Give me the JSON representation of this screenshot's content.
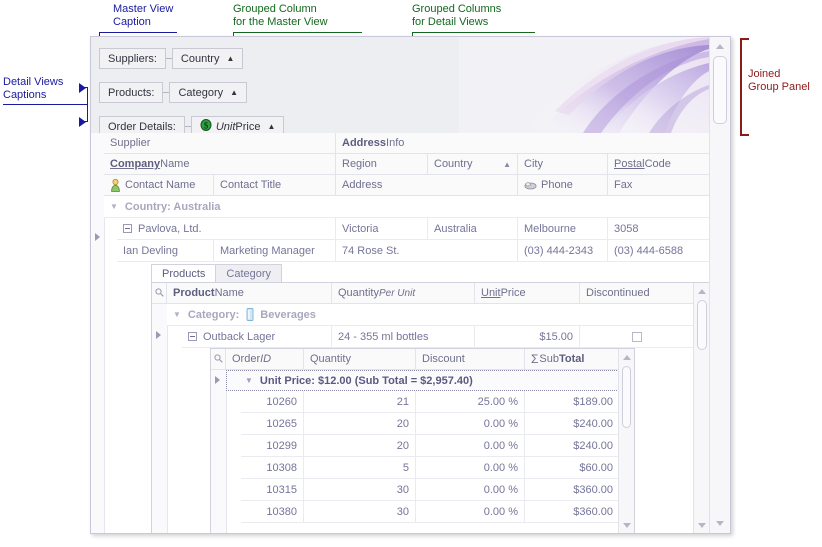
{
  "annotations": {
    "master_view_caption": "Master View\nCaption",
    "grouped_column_master": "Grouped Column\nfor the Master View",
    "grouped_columns_detail": "Grouped Columns\nfor Detail Views",
    "detail_views_captions": "Detail Views\nCaptions",
    "joined_group_panel": "Joined\nGroup Panel"
  },
  "group_panel": {
    "rows": [
      {
        "caption": "Suppliers:",
        "column": "Country",
        "sort": "▲",
        "icon": "",
        "italic_prefix": ""
      },
      {
        "caption": "Products:",
        "column": "Category",
        "sort": "▲",
        "icon": "",
        "italic_prefix": ""
      },
      {
        "caption": "Order Details:",
        "column": "Price",
        "sort": "▲",
        "icon": "money-icon",
        "italic_prefix": "Unit"
      }
    ]
  },
  "master_grid": {
    "band_supplier": "Supplier",
    "band_address_bold": "Address",
    "band_address_rest": " Info",
    "headers": {
      "company_name_bold": "Company",
      "company_name_rest": " Name",
      "region": "Region",
      "country": "Country",
      "country_sort": "▲",
      "city": "City",
      "postal_bold": "Postal",
      "postal_rest": " Code",
      "contact_name": "Contact Name",
      "contact_title": "Contact Title",
      "address": "Address",
      "phone": "Phone",
      "fax": "Fax"
    },
    "group_row": "Country: Australia",
    "row": {
      "company": "Pavlova, Ltd.",
      "region": "Victoria",
      "country": "Australia",
      "city": "Melbourne",
      "postal": "3058",
      "contact_name": "Ian Devling",
      "contact_title": "Marketing Manager",
      "address": "74 Rose St.",
      "phone": "(03) 444-2343",
      "fax": "(03) 444-6588"
    }
  },
  "products_view": {
    "tabs": [
      {
        "label": "Products",
        "active": true
      },
      {
        "label": "Category",
        "active": false
      }
    ],
    "headers": {
      "product_bold": "Product",
      "product_rest": " Name",
      "quantity": "Quantity ",
      "quantity_ital": "Per Unit",
      "unit_underline": "Unit",
      "unit_rest": " Price",
      "discontinued": "Discontinued"
    },
    "group_row_label": "Category:",
    "group_row_value": "Beverages",
    "row": {
      "name": "Outback Lager",
      "quantity": "24 - 355 ml bottles",
      "price": "$15.00",
      "discontinued": false
    }
  },
  "order_details_view": {
    "headers": {
      "order_text": "Order ",
      "order_ital": "ID",
      "quantity": "Quantity",
      "discount": "Discount",
      "sum_glyph": "Σ",
      "subtotal_pre": " Sub ",
      "subtotal_bold": "Total"
    },
    "group_row": "Unit Price: $12.00 (Sub Total = $2,957.40)",
    "rows": [
      {
        "order_id": "10260",
        "quantity": "21",
        "discount": "25.00 %",
        "subtotal": "$189.00"
      },
      {
        "order_id": "10265",
        "quantity": "20",
        "discount": "0.00 %",
        "subtotal": "$240.00"
      },
      {
        "order_id": "10299",
        "quantity": "20",
        "discount": "0.00 %",
        "subtotal": "$240.00"
      },
      {
        "order_id": "10308",
        "quantity": "5",
        "discount": "0.00 %",
        "subtotal": "$60.00"
      },
      {
        "order_id": "10315",
        "quantity": "30",
        "discount": "0.00 %",
        "subtotal": "$360.00"
      },
      {
        "order_id": "10380",
        "quantity": "30",
        "discount": "0.00 %",
        "subtotal": "$360.00"
      }
    ]
  },
  "colors": {
    "annotation_blue": "#1a1aa0",
    "annotation_green": "#14681e",
    "annotation_red": "#8b1a1a",
    "grid_text": "#75759a",
    "panel_bg": "#eceef2",
    "accent_purple": "#b9a8dd"
  }
}
